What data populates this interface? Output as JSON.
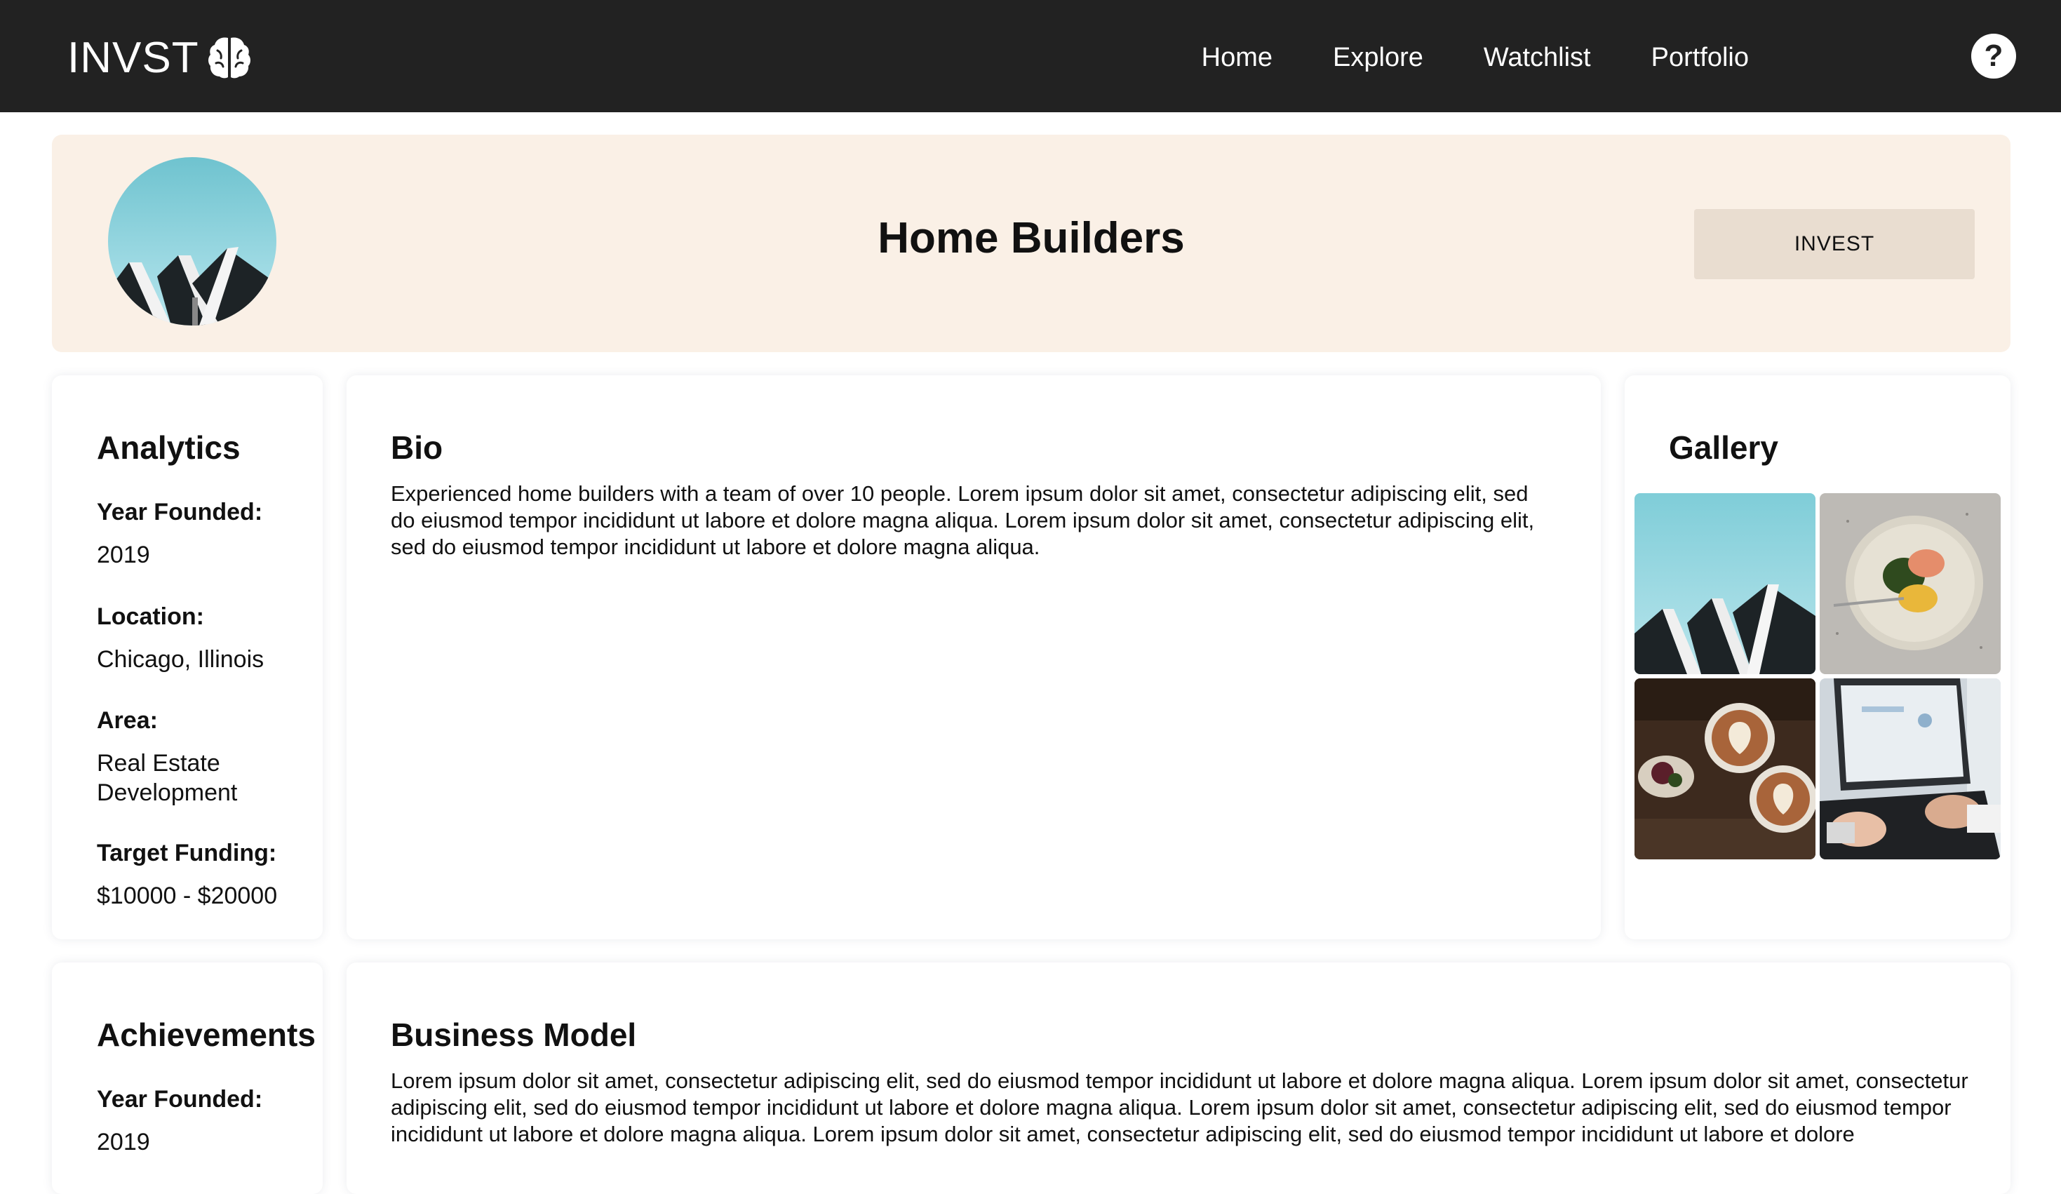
{
  "navbar": {
    "brand": "INVST",
    "brand_icon": "brain-icon",
    "links": [
      "Home",
      "Explore",
      "Watchlist",
      "Portfolio"
    ],
    "help_label": "?",
    "background": "#222222"
  },
  "hero": {
    "title": "Home Builders",
    "invest_label": "INVEST",
    "avatar_icon": "house-rooftops-image",
    "background": "#faf0e6",
    "button_color": "#e9ddd0"
  },
  "analytics": {
    "title": "Analytics",
    "fields": [
      {
        "label": "Year Founded:",
        "value": "2019"
      },
      {
        "label": "Location:",
        "value": "Chicago, Illinois"
      },
      {
        "label": "Area:",
        "value": "Real Estate Development"
      },
      {
        "label": "Target Funding:",
        "value": "$10000 - $20000"
      }
    ]
  },
  "bio": {
    "title": "Bio",
    "text": "Experienced home builders with a team of over 10 people. Lorem ipsum dolor sit amet, consectetur adipiscing elit, sed do eiusmod tempor incididunt ut labore et dolore magna aliqua. Lorem ipsum dolor sit amet, consectetur adipiscing elit, sed do eiusmod tempor incididunt ut labore et dolore magna aliqua."
  },
  "gallery": {
    "title": "Gallery",
    "images": [
      "house-rooftops-image",
      "salmon-dish-image",
      "latte-art-image",
      "laptop-typing-image"
    ]
  },
  "achievements": {
    "title": "Achievements",
    "fields": [
      {
        "label": "Year Founded:",
        "value": "2019"
      }
    ]
  },
  "business_model": {
    "title": "Business Model",
    "text": "Lorem ipsum dolor sit amet, consectetur adipiscing elit, sed do eiusmod tempor incididunt ut labore et dolore magna aliqua. Lorem ipsum dolor sit amet, consectetur adipiscing elit, sed do eiusmod tempor incididunt ut labore et dolore magna aliqua. Lorem ipsum dolor sit amet, consectetur adipiscing elit, sed do eiusmod tempor incididunt ut labore et dolore magna aliqua. Lorem ipsum dolor sit amet, consectetur adipiscing elit, sed do eiusmod tempor incididunt ut labore et dolore"
  }
}
